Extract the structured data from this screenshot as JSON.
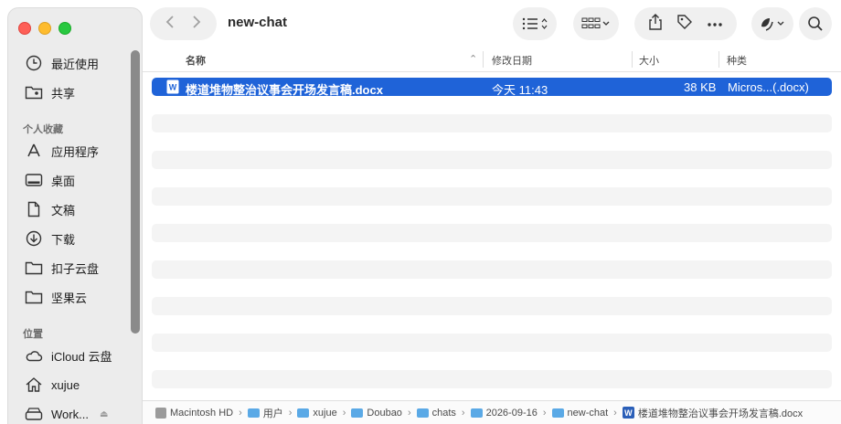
{
  "window": {
    "title": "new-chat"
  },
  "sidebar": {
    "top_items": [
      {
        "label": "最近使用",
        "icon": "clock-icon"
      },
      {
        "label": "共享",
        "icon": "shared-folder-icon"
      }
    ],
    "favorites_label": "个人收藏",
    "favorites": [
      {
        "label": "应用程序",
        "icon": "applications-icon"
      },
      {
        "label": "桌面",
        "icon": "desktop-icon"
      },
      {
        "label": "文稿",
        "icon": "document-icon"
      },
      {
        "label": "下载",
        "icon": "download-icon"
      },
      {
        "label": "扣子云盘",
        "icon": "folder-icon"
      },
      {
        "label": "坚果云",
        "icon": "folder-icon"
      }
    ],
    "locations_label": "位置",
    "locations": [
      {
        "label": "iCloud 云盘",
        "icon": "cloud-icon"
      },
      {
        "label": "xujue",
        "icon": "home-icon"
      },
      {
        "label": "Work...",
        "icon": "drive-icon"
      }
    ]
  },
  "columns": {
    "name": "名称",
    "modified": "修改日期",
    "size": "大小",
    "kind": "种类"
  },
  "files": [
    {
      "name": "楼道堆物整治议事会开场发言稿.docx",
      "modified": "今天 11:43",
      "size": "38 KB",
      "kind": "Micros...(.docx)",
      "icon_letter": "W"
    }
  ],
  "pathbar": {
    "crumbs": [
      "Macintosh HD",
      "用户",
      "xujue",
      "Doubao",
      "chats",
      "2026-09-16",
      "new-chat"
    ],
    "file": "楼道堆物整治议事会开场发言稿.docx"
  },
  "colors": {
    "selection": "#1f63d8",
    "folder": "#5aa9e6"
  }
}
